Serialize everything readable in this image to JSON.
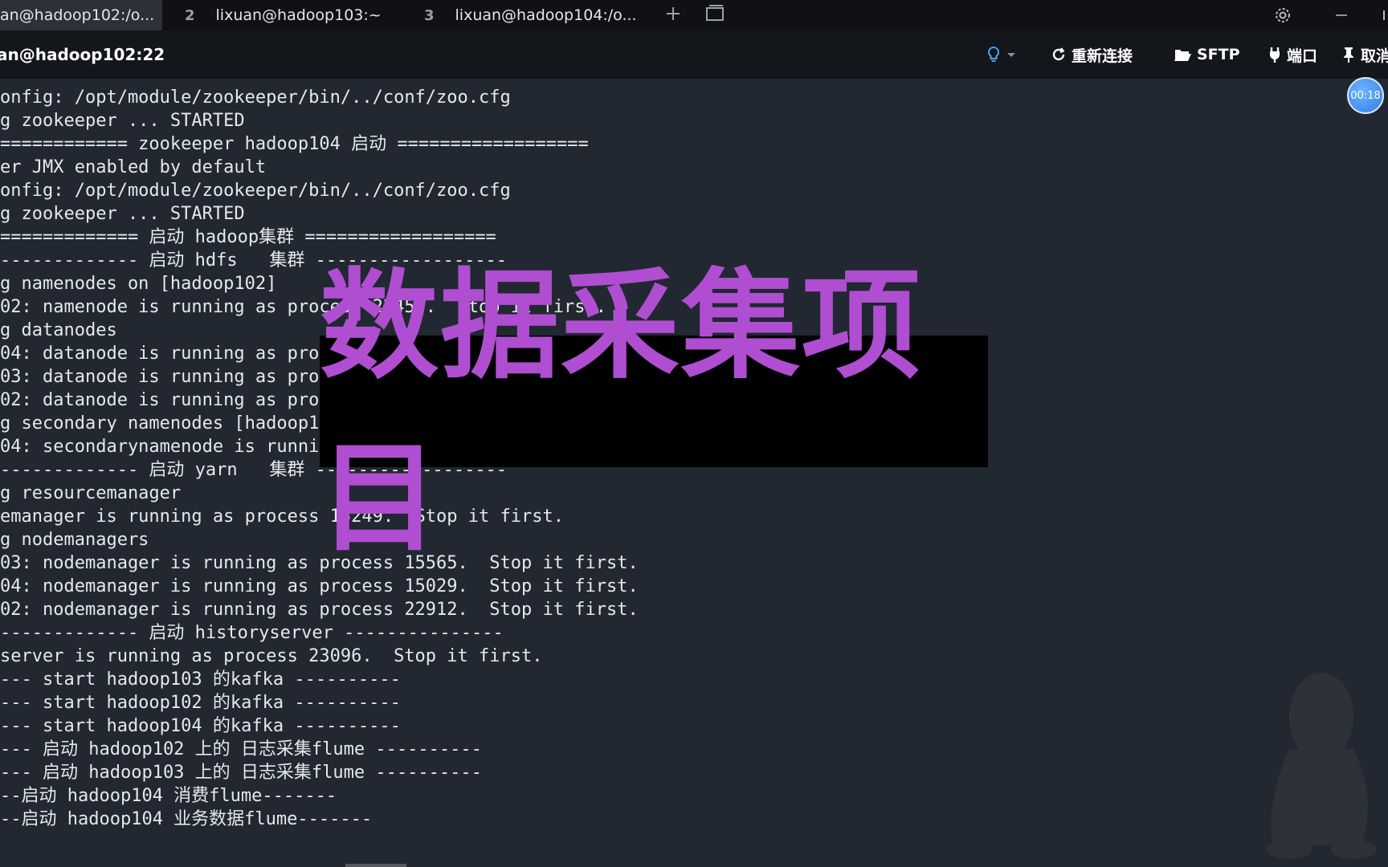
{
  "tabs": [
    {
      "num": "",
      "label": "an@hadoop102:/o..."
    },
    {
      "num": "2",
      "label": "lixuan@hadoop103:~"
    },
    {
      "num": "3",
      "label": "lixuan@hadoop104:/o..."
    }
  ],
  "toolbar": {
    "session_title": "an@hadoop102:22",
    "reconnect_label": "重新连接",
    "sftp_label": "SFTP",
    "port_label": "端口",
    "pin_label": "取消"
  },
  "timer": "00:18",
  "overlay_title": "数据采集项目",
  "terminal_lines": [
    "onfig: /opt/module/zookeeper/bin/../conf/zoo.cfg",
    "g zookeeper ... STARTED",
    "============ zookeeper hadoop104 启动 ==================",
    "er JMX enabled by default",
    "onfig: /opt/module/zookeeper/bin/../conf/zoo.cfg",
    "g zookeeper ... STARTED",
    "============= 启动 hadoop集群 ==================",
    "------------- 启动 hdfs   集群 ------------------",
    "g namenodes on [hadoop102]",
    "02: namenode is running as process 22453.  Stop it first.",
    "g datanodes",
    "04: datanode is running as process 14822.  Stop it first.",
    "03: datanode is running as proc",
    "02: datanode is running as proc",
    "g secondary namenodes [hadoop10",
    "04: secondarynamenode is runnir",
    "------------- 启动 yarn   集群 ------------------",
    "g resourcemanager",
    "emanager is running as process 15249.  Stop it first.",
    "g nodemanagers",
    "03: nodemanager is running as process 15565.  Stop it first.",
    "04: nodemanager is running as process 15029.  Stop it first.",
    "02: nodemanager is running as process 22912.  Stop it first.",
    "------------- 启动 historyserver ---------------",
    "server is running as process 23096.  Stop it first.",
    "--- start hadoop103 的kafka ----------",
    "--- start hadoop102 的kafka ----------",
    "--- start hadoop104 的kafka ----------",
    "--- 启动 hadoop102 上的 日志采集flume ----------",
    "--- 启动 hadoop103 上的 日志采集flume ----------",
    "--启动 hadoop104 消费flume-------",
    "--启动 hadoop104 业务数据flume-------"
  ]
}
